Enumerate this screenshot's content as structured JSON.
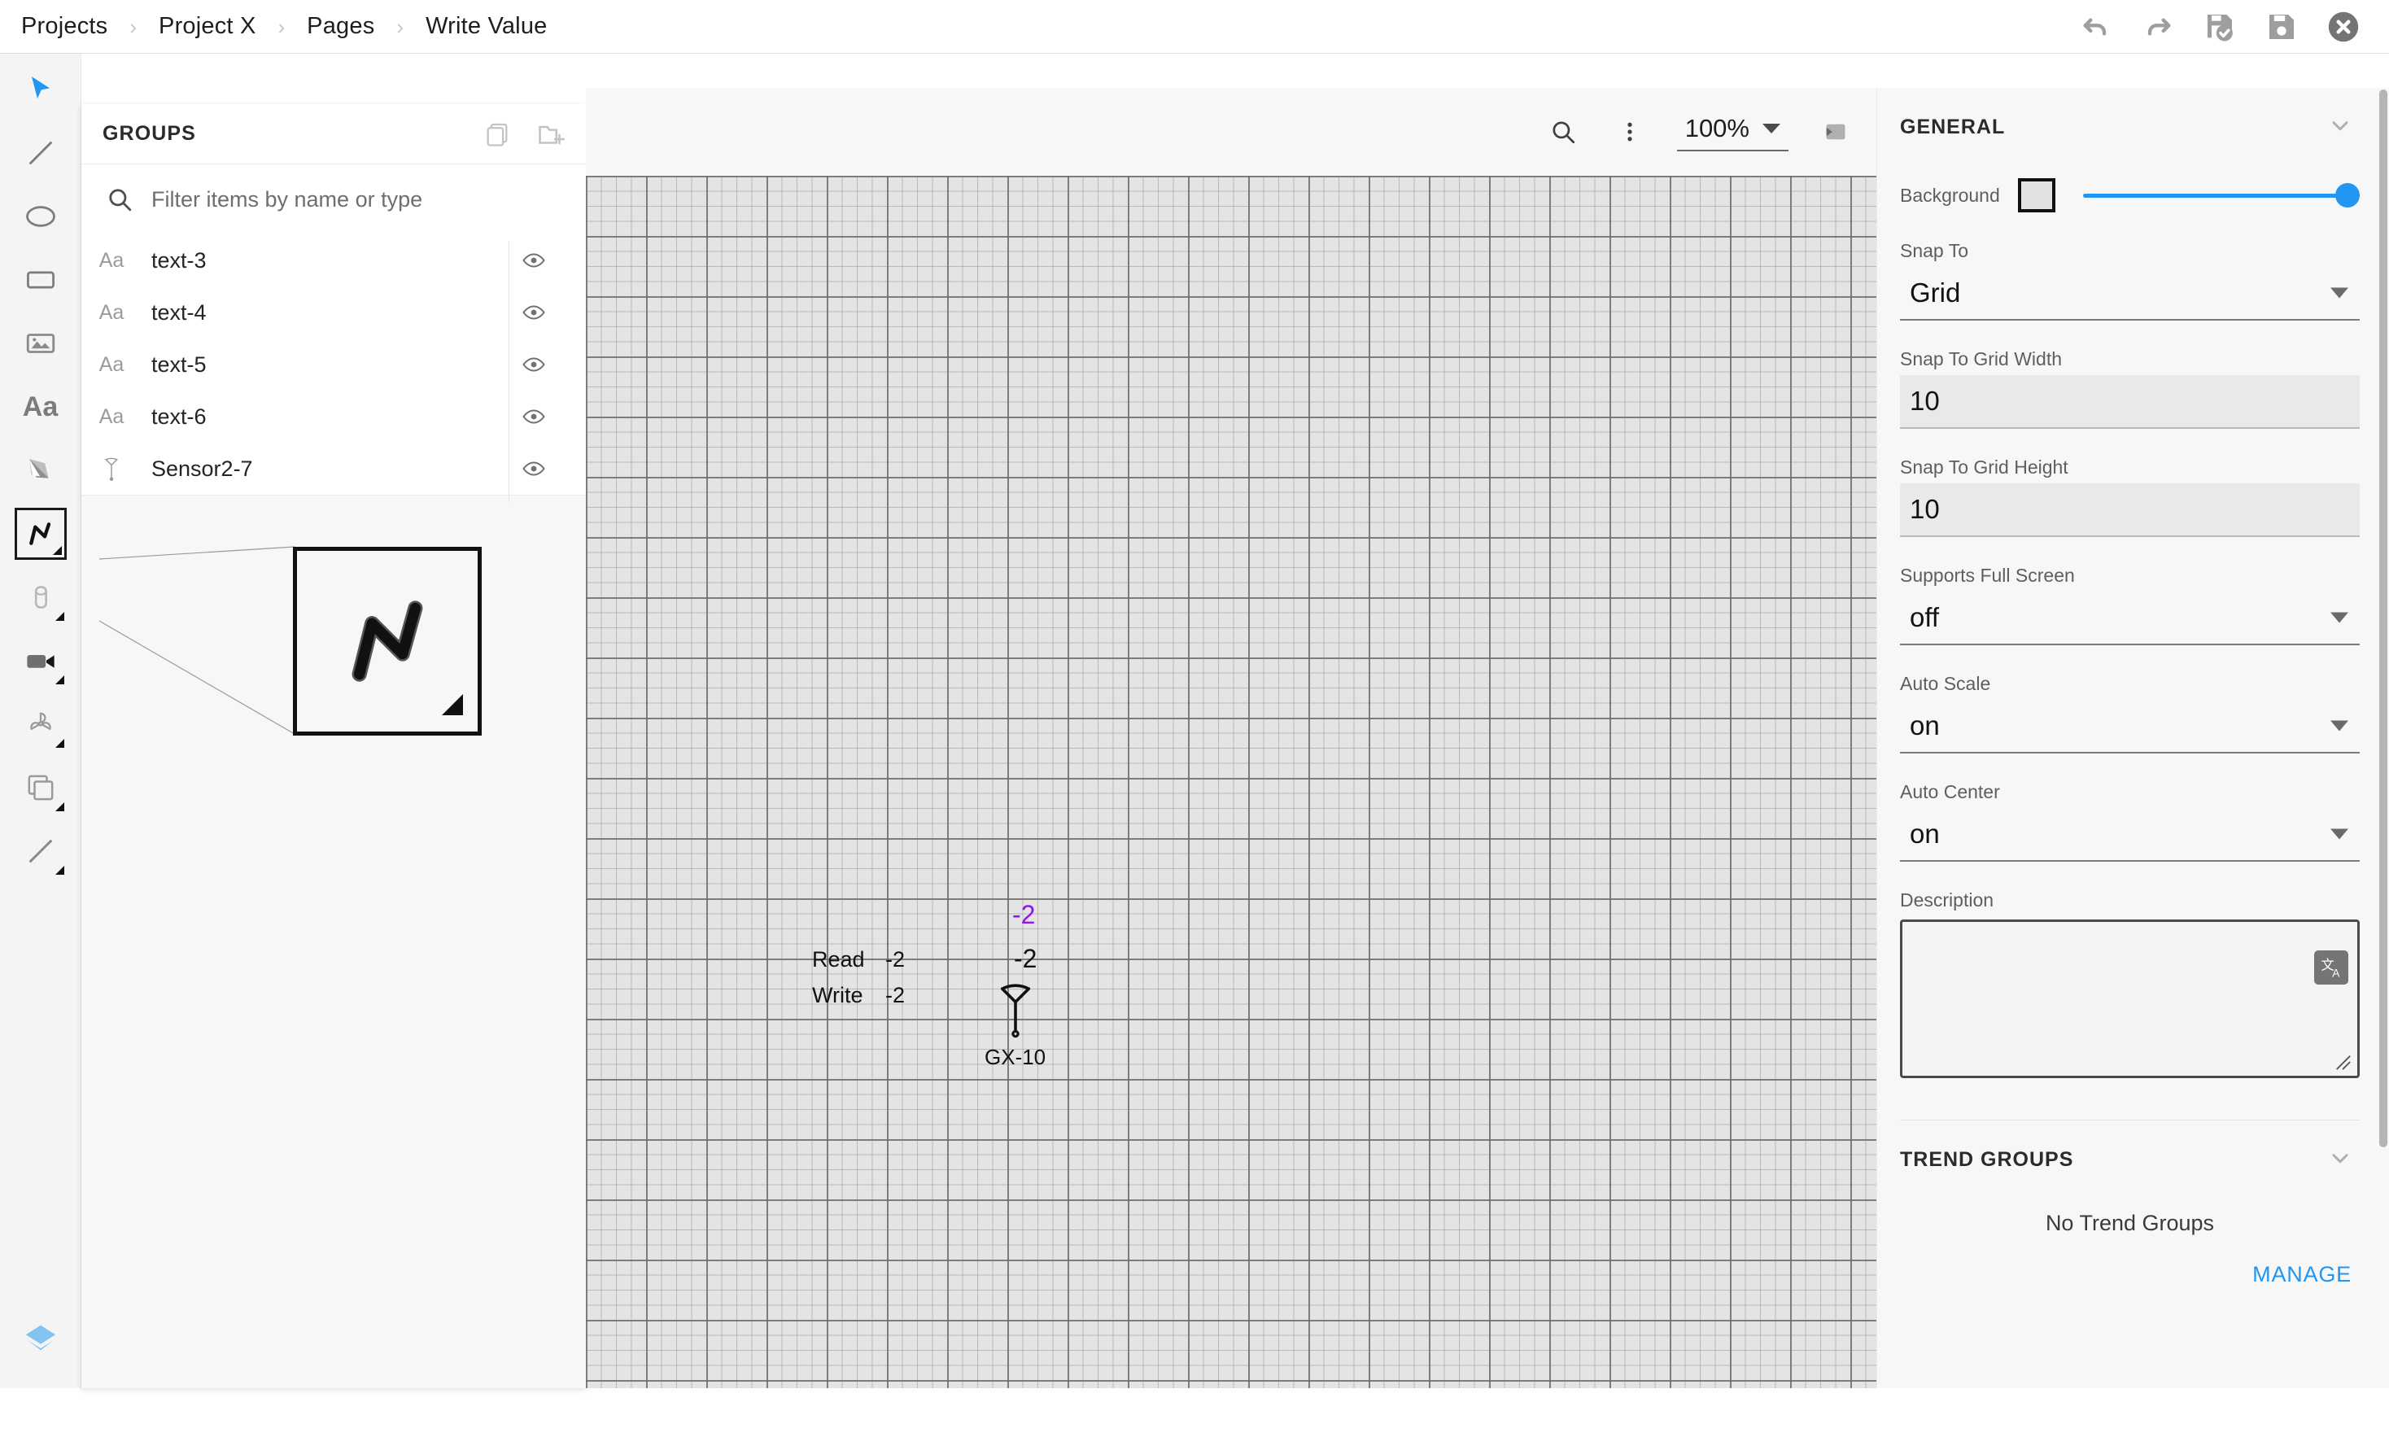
{
  "breadcrumb": {
    "items": [
      "Projects",
      "Project X",
      "Pages",
      "Write Value"
    ],
    "separator": "›"
  },
  "top_actions": [
    {
      "name": "undo",
      "label": "Undo"
    },
    {
      "name": "redo",
      "label": "Redo"
    },
    {
      "name": "save-and-close",
      "label": "Save and Close"
    },
    {
      "name": "save",
      "label": "Save"
    },
    {
      "name": "close",
      "label": "Close"
    }
  ],
  "toolbar": {
    "tools": [
      {
        "name": "select-cursor",
        "label": "Select",
        "selected": false,
        "submenu": false
      },
      {
        "name": "line",
        "label": "Line",
        "selected": false,
        "submenu": false
      },
      {
        "name": "ellipse",
        "label": "Ellipse",
        "selected": false,
        "submenu": false
      },
      {
        "name": "rectangle",
        "label": "Rectangle",
        "selected": false,
        "submenu": false
      },
      {
        "name": "image",
        "label": "Image",
        "selected": false,
        "submenu": false
      },
      {
        "name": "text",
        "label": "Text",
        "selected": false,
        "submenu": false
      },
      {
        "name": "pen",
        "label": "Pen",
        "selected": false,
        "submenu": false
      },
      {
        "name": "trend-zigzag",
        "label": "Trend",
        "selected": true,
        "submenu": true
      },
      {
        "name": "tank",
        "label": "Tank",
        "selected": false,
        "submenu": true
      },
      {
        "name": "camera",
        "label": "Camera",
        "selected": false,
        "submenu": true
      },
      {
        "name": "fan",
        "label": "Fan",
        "selected": false,
        "submenu": true
      },
      {
        "name": "copy-shapes",
        "label": "Shapes",
        "selected": false,
        "submenu": true
      },
      {
        "name": "connector-line",
        "label": "Connector",
        "selected": false,
        "submenu": true
      }
    ],
    "layers_button": {
      "name": "layers",
      "label": "Layers"
    }
  },
  "groups_panel": {
    "title": "GROUPS",
    "header_actions": [
      {
        "name": "duplicate",
        "label": "Duplicate"
      },
      {
        "name": "new-folder",
        "label": "New Folder"
      }
    ],
    "filter": {
      "placeholder": "Filter items by name or type",
      "value": ""
    },
    "items": [
      {
        "label": "text-3",
        "type_icon": "Aa",
        "visible": true
      },
      {
        "label": "text-4",
        "type_icon": "Aa",
        "visible": true
      },
      {
        "label": "text-5",
        "type_icon": "Aa",
        "visible": true
      },
      {
        "label": "text-6",
        "type_icon": "Aa",
        "visible": true
      },
      {
        "label": "Sensor2-7",
        "type_icon": "sensor",
        "visible": true
      }
    ]
  },
  "canvas_toolbar": {
    "search_label": "Search",
    "menu_label": "More options",
    "zoom_value": "100%",
    "collapse_label": "Collapse panel"
  },
  "canvas": {
    "read_label": "Read",
    "read_value": "-2",
    "write_label": "Write",
    "write_value": "-2",
    "purple_value": "-2",
    "black_value": "-2",
    "sensor_label": "GX-10",
    "purple_color": "#8f14f0"
  },
  "properties": {
    "general": {
      "title": "GENERAL",
      "background_label": "Background",
      "background_color": "#e2e2e2",
      "opacity_percent": 100,
      "accent_color": "#2196f3",
      "fields": [
        {
          "label": "Snap To",
          "value": "Grid",
          "control": "select"
        },
        {
          "label": "Snap To Grid Width",
          "value": "10",
          "control": "input"
        },
        {
          "label": "Snap To Grid Height",
          "value": "10",
          "control": "input"
        },
        {
          "label": "Supports Full Screen",
          "value": "off",
          "control": "select"
        },
        {
          "label": "Auto Scale",
          "value": "on",
          "control": "select"
        },
        {
          "label": "Auto Center",
          "value": "on",
          "control": "select"
        }
      ],
      "description_label": "Description",
      "description_value": "",
      "translate_icon": "文A"
    },
    "trend_groups": {
      "title": "TREND GROUPS",
      "empty_text": "No Trend Groups",
      "manage_label": "MANAGE"
    }
  }
}
